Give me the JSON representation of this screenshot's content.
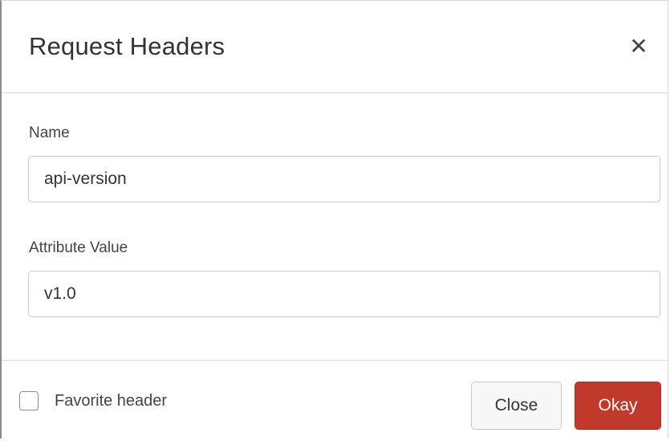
{
  "dialog": {
    "title": "Request Headers",
    "close_icon": "close-icon"
  },
  "form": {
    "name_label": "Name",
    "name_value": "api-version",
    "value_label": "Attribute Value",
    "value_value": "v1.0"
  },
  "footer": {
    "favorite_label": "Favorite header",
    "favorite_checked": false,
    "close_label": "Close",
    "okay_label": "Okay"
  },
  "colors": {
    "primary_button": "#c0392b",
    "border": "#c8c8c8"
  }
}
